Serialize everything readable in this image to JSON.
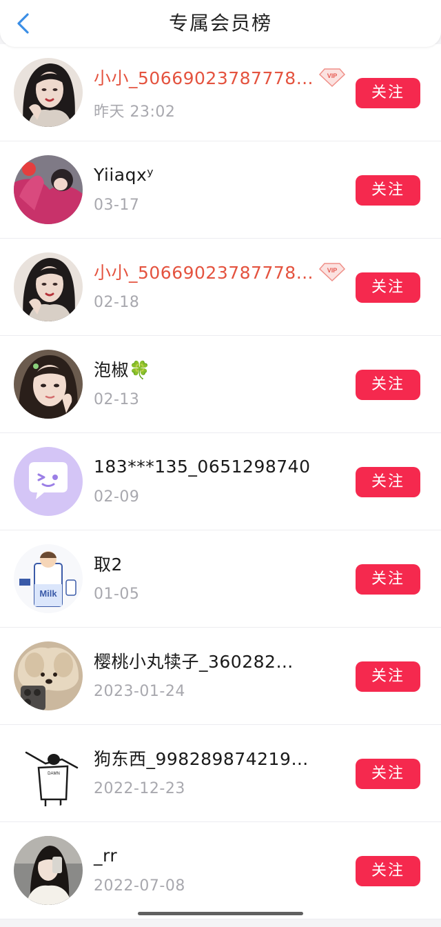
{
  "header": {
    "title": "专属会员榜",
    "back_icon": "chevron-left-icon",
    "accent": "#3a8ee6"
  },
  "colors": {
    "follow_button": "#f5294e",
    "vip_name": "#e4533f",
    "date_text": "#a8a8ae"
  },
  "members": [
    {
      "name": "小小_50669023787778…",
      "vip": true,
      "date": "昨天 23:02",
      "follow_label": "关注",
      "avatar": "woman-portrait-avatar"
    },
    {
      "name": "Yiiaqxʸ",
      "vip": false,
      "date": "03-17",
      "follow_label": "关注",
      "avatar": "pink-hoodie-avatar"
    },
    {
      "name": "小小_50669023787778…",
      "vip": true,
      "date": "02-18",
      "follow_label": "关注",
      "avatar": "woman-portrait-avatar"
    },
    {
      "name": "泡椒🍀",
      "vip": false,
      "date": "02-13",
      "follow_label": "关注",
      "avatar": "girl-selfie-avatar"
    },
    {
      "name": "183***135_0651298740",
      "vip": false,
      "date": "02-09",
      "follow_label": "关注",
      "avatar": "chat-bubble-default-avatar"
    },
    {
      "name": "取2",
      "vip": false,
      "date": "01-05",
      "follow_label": "关注",
      "avatar": "milk-carton-cartoon-avatar"
    },
    {
      "name": "樱桃小丸犊子_360282…",
      "vip": false,
      "date": "2023-01-24",
      "follow_label": "关注",
      "avatar": "dog-with-phone-avatar"
    },
    {
      "name": "狗东西_998289874219…",
      "vip": false,
      "date": "2022-12-23",
      "follow_label": "关注",
      "avatar": "dab-sketch-avatar"
    },
    {
      "name": "_rr",
      "vip": false,
      "date": "2022-07-08",
      "follow_label": "关注",
      "avatar": "mirror-selfie-avatar"
    }
  ]
}
